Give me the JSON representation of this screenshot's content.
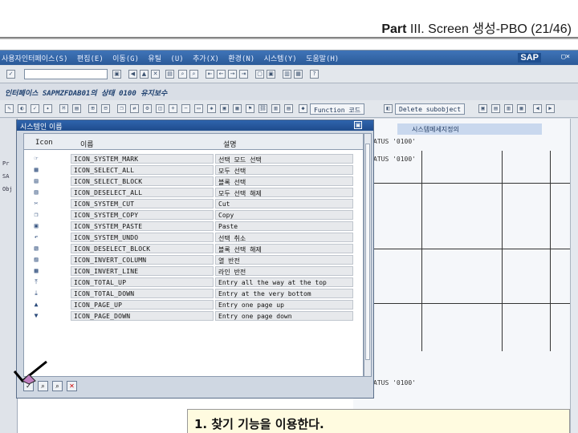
{
  "slide": {
    "title_bold": "Part",
    "title_rest": "III. Screen 생성-PBO (21/46)"
  },
  "menubar": {
    "items": [
      "사용자인터페이스(S)",
      "편집(E)",
      "이동(G)",
      "유틸",
      "(U)",
      "추가(X)",
      "환경(N)",
      "시스템(Y)",
      "도움말(H)"
    ],
    "logo": "SAP"
  },
  "titlebar": {
    "text": "인터페이스 SAPMZFDAB01의 상태 0100 유지보수"
  },
  "apptool": {
    "function_code_label": "Function 코드",
    "delete_subobject_label": "Delete subobject"
  },
  "rightarea": {
    "header": "시스템메세지정의",
    "status1": "ATUS '0100'",
    "status2": "ATUS '0100'",
    "status3": "ATUS '0100'"
  },
  "dialog": {
    "title": "시스템인 이름",
    "col_icon": "Icon",
    "col_name": "이름",
    "col_desc": "설명",
    "rows": [
      {
        "icon": "☞",
        "name": "ICON_SYSTEM_MARK",
        "desc": "선택 모드 선택"
      },
      {
        "icon": "▦",
        "name": "ICON_SELECT_ALL",
        "desc": "모두 선택"
      },
      {
        "icon": "▤",
        "name": "ICON_SELECT_BLOCK",
        "desc": "블록 선택"
      },
      {
        "icon": "▥",
        "name": "ICON_DESELECT_ALL",
        "desc": "모두 선택 해제"
      },
      {
        "icon": "✂",
        "name": "ICON_SYSTEM_CUT",
        "desc": "Cut"
      },
      {
        "icon": "❐",
        "name": "ICON_SYSTEM_COPY",
        "desc": "Copy"
      },
      {
        "icon": "▣",
        "name": "ICON_SYSTEM_PASTE",
        "desc": "Paste"
      },
      {
        "icon": "↶",
        "name": "ICON_SYSTEM_UNDO",
        "desc": "선택 취소"
      },
      {
        "icon": "▧",
        "name": "ICON_DESELECT_BLOCK",
        "desc": "블록 선택 해제"
      },
      {
        "icon": "▨",
        "name": "ICON_INVERT_COLUMN",
        "desc": "열 반전"
      },
      {
        "icon": "▩",
        "name": "ICON_INVERT_LINE",
        "desc": "라인 반전"
      },
      {
        "icon": "⤒",
        "name": "ICON_TOTAL_UP",
        "desc": "Entry all the way at the top"
      },
      {
        "icon": "⤓",
        "name": "ICON_TOTAL_DOWN",
        "desc": "Entry at the very bottom"
      },
      {
        "icon": "▲",
        "name": "ICON_PAGE_UP",
        "desc": "Entry one page up"
      },
      {
        "icon": "▼",
        "name": "ICON_PAGE_DOWN",
        "desc": "Entry one page down"
      }
    ]
  },
  "callout": {
    "text": "1. 찾기 기능을 이용한다."
  },
  "left_labels": [
    "Pr",
    "SA",
    "Obj"
  ]
}
